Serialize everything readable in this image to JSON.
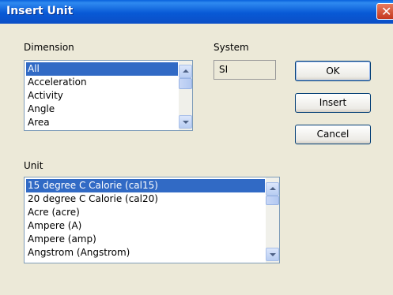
{
  "window": {
    "title": "Insert Unit",
    "close_symbol": "✕"
  },
  "dimension": {
    "label": "Dimension",
    "items": [
      "All",
      "Acceleration",
      "Activity",
      "Angle",
      "Area"
    ],
    "selected_index": 0
  },
  "system": {
    "label": "System",
    "value": "SI"
  },
  "buttons": {
    "ok": "OK",
    "insert": "Insert",
    "cancel": "Cancel"
  },
  "unit": {
    "label": "Unit",
    "items": [
      "15 degree C Calorie (cal15)",
      "20 degree C Calorie (cal20)",
      "Acre (acre)",
      "Ampere (A)",
      "Ampere (amp)",
      "Angstrom (Angstrom)"
    ],
    "selected_index": 0
  }
}
